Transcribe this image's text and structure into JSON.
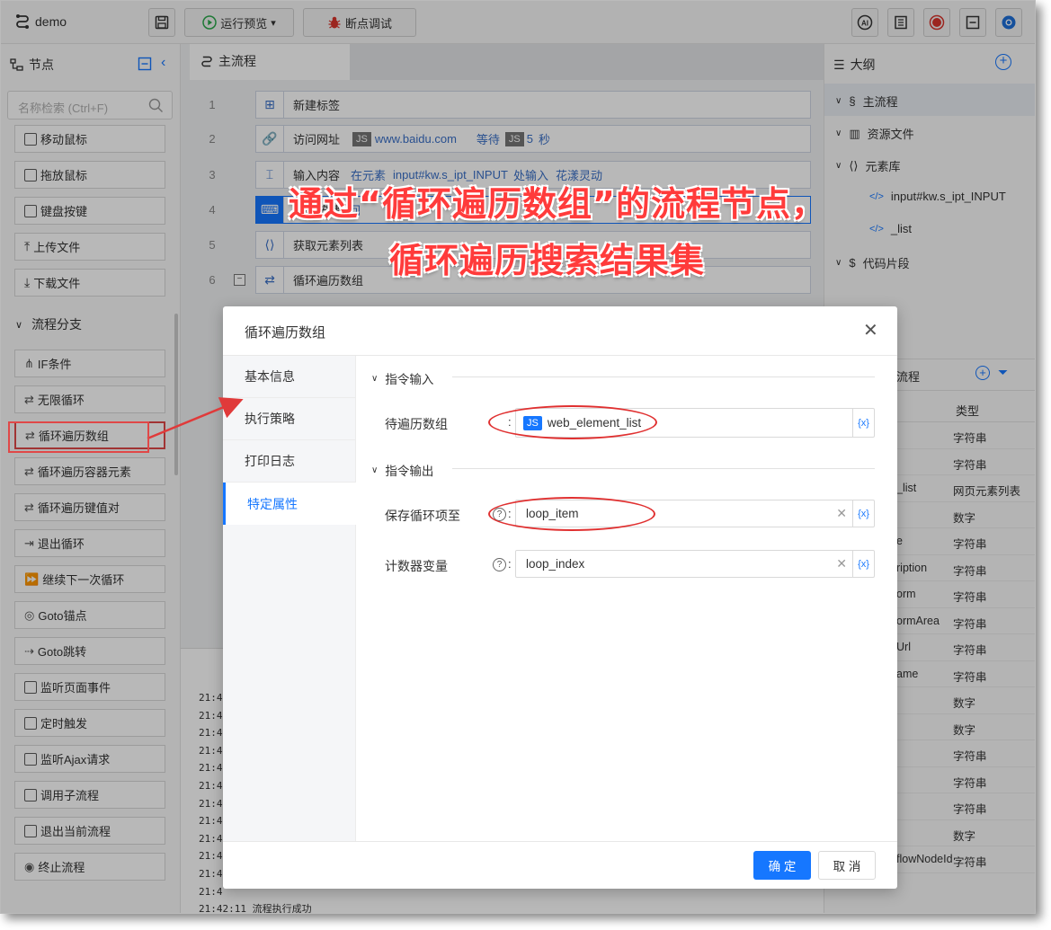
{
  "app": {
    "title": "demo"
  },
  "toolbar": {
    "run_preview": "运行预览",
    "breakpoint_debug": "断点调试"
  },
  "left_panel": {
    "title": "节点",
    "search_placeholder": "名称检索 (Ctrl+F)",
    "nodes_top": [
      "移动鼠标",
      "拖放鼠标",
      "键盘按键",
      "上传文件",
      "下载文件"
    ],
    "group_title": "流程分支",
    "nodes_branch": [
      "IF条件",
      "无限循环",
      "循环遍历数组",
      "循环遍历容器元素",
      "循环遍历键值对",
      "退出循环",
      "继续下一次循环",
      "Goto锚点",
      "Goto跳转",
      "监听页面事件",
      "定时触发",
      "监听Ajax请求",
      "调用子流程",
      "退出当前流程",
      "终止流程"
    ]
  },
  "center": {
    "tab": "主流程",
    "steps": [
      {
        "no": "1",
        "label": "新建标签"
      },
      {
        "no": "2",
        "label": "访问网址",
        "js": "JS",
        "value": "www.baidu.com",
        "wait": "等待",
        "wait_val": "5",
        "unit": "秒"
      },
      {
        "no": "3",
        "label": "输入内容",
        "extra": "在元素",
        "target": "input#kw.s_ipt_INPUT",
        "mid": "处输入",
        "value": "花漾灵动"
      },
      {
        "no": "4",
        "label": "键盘按键",
        "extra": "回"
      },
      {
        "no": "5",
        "label": "获取元素列表"
      },
      {
        "no": "6",
        "label": "循环遍历数组"
      }
    ],
    "log_times": [
      "21:4",
      "21:4",
      "21:4",
      "21:4",
      "21:4",
      "21:4",
      "21:4",
      "21:4",
      "21:4",
      "21:4",
      "21:4",
      "21:4"
    ],
    "log_last": "21:42:11  流程执行成功"
  },
  "right_panel": {
    "title": "大纲",
    "tree": [
      {
        "label": "主流程"
      },
      {
        "label": "资源文件"
      },
      {
        "label": "元素库"
      },
      {
        "label": "input#kw.s_ipt_INPUT"
      },
      {
        "label": "_list"
      },
      {
        "label": "代码片段"
      }
    ],
    "var_title": "流程",
    "col_type": "类型",
    "rows": [
      {
        "name": "",
        "type": "字符串"
      },
      {
        "name": "",
        "type": "字符串"
      },
      {
        "name": "_list",
        "type": "网页元素列表"
      },
      {
        "name": "",
        "type": "数字"
      },
      {
        "name": "e",
        "type": "字符串"
      },
      {
        "name": "ription",
        "type": "字符串"
      },
      {
        "name": "orm",
        "type": "字符串"
      },
      {
        "name": "ormArea",
        "type": "字符串"
      },
      {
        "name": "Url",
        "type": "字符串"
      },
      {
        "name": "ame",
        "type": "字符串"
      },
      {
        "name": "",
        "type": "数字"
      },
      {
        "name": "",
        "type": "数字"
      },
      {
        "name": "",
        "type": "字符串"
      },
      {
        "name": "",
        "type": "字符串"
      },
      {
        "name": "",
        "type": "字符串"
      },
      {
        "name": "",
        "type": "数字"
      },
      {
        "name": "flowNodeId",
        "type": "字符串"
      }
    ]
  },
  "annotation": {
    "line1": "通过“循环遍历数组”的流程节点，",
    "line2": "循环遍历搜索结果集"
  },
  "dialog": {
    "title": "循环遍历数组",
    "tabs": [
      "基本信息",
      "执行策略",
      "打印日志",
      "特定属性"
    ],
    "section_input": "指令输入",
    "section_output": "指令输出",
    "field_array_label": "待遍历数组",
    "field_array_js": "JS",
    "field_array_value": "web_element_list",
    "field_item_label": "保存循环项至",
    "field_item_value": "loop_item",
    "field_index_label": "计数器变量",
    "field_index_value": "loop_index",
    "var_btn": "{x}",
    "help": "?",
    "colon": ":",
    "ok": "确 定",
    "cancel": "取 消"
  },
  "colors": {
    "accent": "#1677ff",
    "annotation": "#ff3b3b"
  }
}
